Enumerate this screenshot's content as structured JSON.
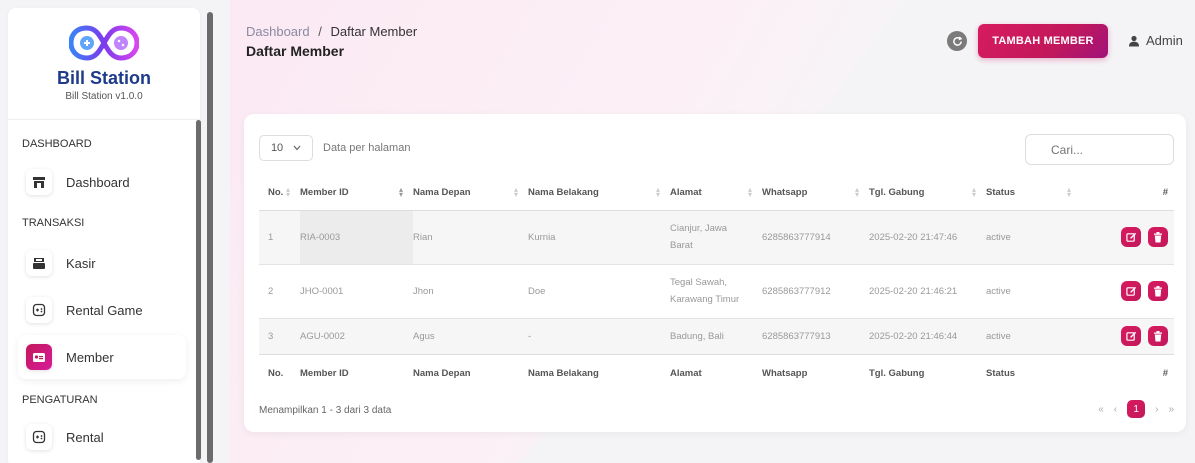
{
  "brand": {
    "title": "Bill Station",
    "subtitle": "Bill Station v1.0.0"
  },
  "sidebar": {
    "sections": [
      {
        "heading": "DASHBOARD"
      },
      {
        "heading": "TRANSAKSI"
      },
      {
        "heading": "PENGATURAN"
      }
    ],
    "items": [
      {
        "label": "Dashboard",
        "icon": "store-icon"
      },
      {
        "label": "Kasir",
        "icon": "cashier-icon"
      },
      {
        "label": "Rental Game",
        "icon": "gamepad-icon"
      },
      {
        "label": "Member",
        "icon": "member-card-icon"
      },
      {
        "label": "Rental",
        "icon": "gamepad-icon"
      }
    ]
  },
  "header": {
    "breadcrumb_root": "Dashboard",
    "breadcrumb_sep": "/",
    "breadcrumb_current": "Daftar Member",
    "title": "Daftar Member",
    "add_button": "TAMBAH MEMBER",
    "user": "Admin"
  },
  "table_controls": {
    "per_page_value": "10",
    "per_page_label": "Data per halaman",
    "search_placeholder": "Cari..."
  },
  "table": {
    "columns": [
      "No.",
      "Member ID",
      "Nama Depan",
      "Nama Belakang",
      "Alamat",
      "Whatsapp",
      "Tgl. Gabung",
      "Status",
      "#"
    ],
    "rows": [
      {
        "no": "1",
        "member_id": "RIA-0003",
        "nama_depan": "Rian",
        "nama_belakang": "Kurnia",
        "alamat": "Cianjur, Jawa Barat",
        "whatsapp": "6285863777914",
        "tgl_gabung": "2025-02-20 21:47:46",
        "status": "active"
      },
      {
        "no": "2",
        "member_id": "JHO-0001",
        "nama_depan": "Jhon",
        "nama_belakang": "Doe",
        "alamat": "Tegal Sawah, Karawang Timur",
        "whatsapp": "6285863777912",
        "tgl_gabung": "2025-02-20 21:46:21",
        "status": "active"
      },
      {
        "no": "3",
        "member_id": "AGU-0002",
        "nama_depan": "Agus",
        "nama_belakang": "-",
        "alamat": "Badung, Bali",
        "whatsapp": "6285863777913",
        "tgl_gabung": "2025-02-20 21:46:44",
        "status": "active"
      }
    ]
  },
  "footer": {
    "info": "Menampilkan 1 - 3 dari 3 data",
    "pager": {
      "first": "«",
      "prev": "‹",
      "current": "1",
      "next": "›",
      "last": "»"
    }
  },
  "colors": {
    "accent": "#c2185b",
    "brand_title": "#1e3a8a"
  }
}
